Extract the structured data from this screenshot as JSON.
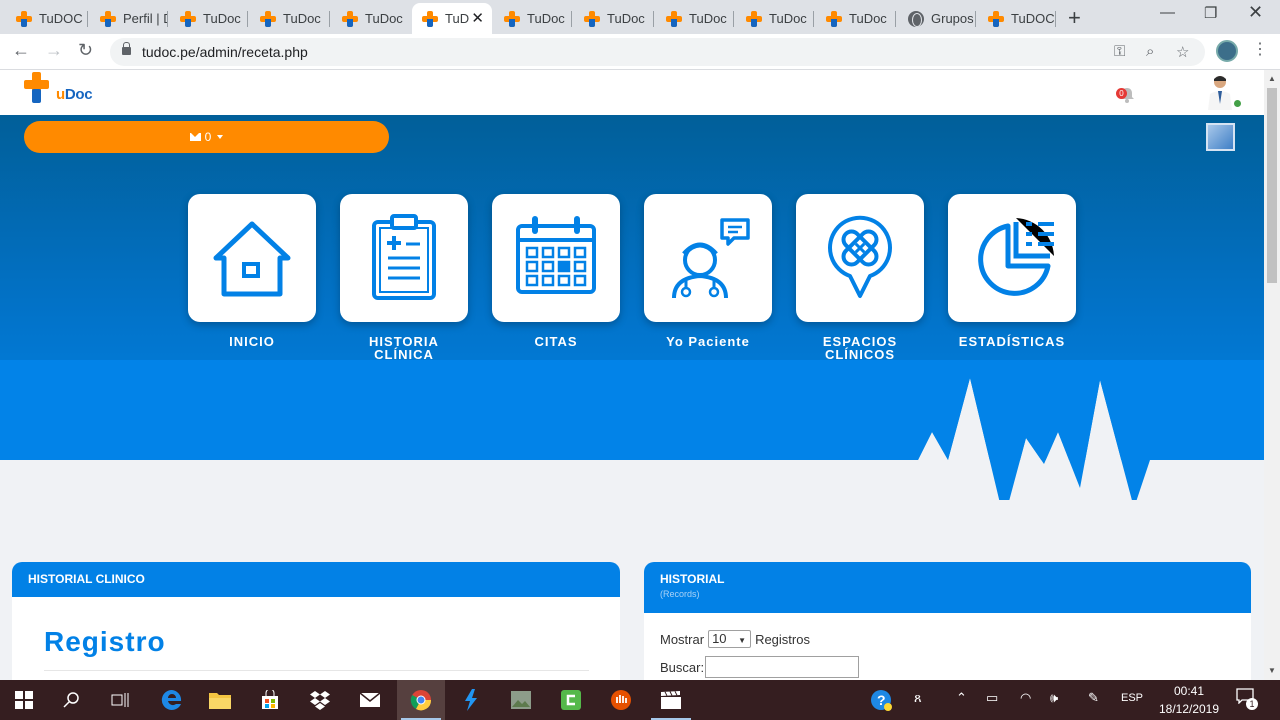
{
  "browser": {
    "tabs": [
      {
        "title": "TuDOC",
        "icon": "tudoc-favicon"
      },
      {
        "title": "Perfil | D",
        "icon": "tudoc-favicon"
      },
      {
        "title": "TuDoc",
        "icon": "tudoc-favicon"
      },
      {
        "title": "TuDoc",
        "icon": "tudoc-favicon"
      },
      {
        "title": "TuDoc",
        "icon": "tudoc-favicon"
      },
      {
        "title": "TuD",
        "icon": "tudoc-favicon",
        "active": true
      },
      {
        "title": "TuDoc",
        "icon": "tudoc-favicon"
      },
      {
        "title": "TuDoc",
        "icon": "tudoc-favicon"
      },
      {
        "title": "TuDoc",
        "icon": "tudoc-favicon"
      },
      {
        "title": "TuDoc",
        "icon": "tudoc-favicon"
      },
      {
        "title": "TuDoc",
        "icon": "tudoc-favicon"
      },
      {
        "title": "Grupos",
        "icon": "globe-icon"
      },
      {
        "title": "TuDOC",
        "icon": "tudoc-favicon"
      }
    ],
    "url": "tudoc.pe/admin/receta.php"
  },
  "header": {
    "logo_text_prefix": "u",
    "logo_text_suffix": "Doc",
    "notification_count": "0"
  },
  "hero": {
    "messages_count": "0",
    "menu": [
      {
        "label": "INICIO",
        "icon": "home-icon"
      },
      {
        "label": "HISTORIA\nCLÍNICA",
        "icon": "clipboard-icon"
      },
      {
        "label": "CITAS",
        "icon": "calendar-icon"
      },
      {
        "label": "Yo Paciente",
        "icon": "doctor-chat-icon"
      },
      {
        "label": "ESPACIOS\nCLÍNICOS",
        "icon": "location-medical-icon"
      },
      {
        "label": "ESTADÍSTICAS",
        "icon": "pie-chart-icon"
      }
    ]
  },
  "panels": {
    "left": {
      "title": "HISTORIAL CLINICO",
      "heading": "Registro"
    },
    "right": {
      "title": "HISTORIAL",
      "subtitle": "(Records)",
      "show_label": "Mostrar",
      "page_size": "10",
      "records_label": "Registros",
      "search_label": "Buscar:"
    }
  },
  "taskbar": {
    "language": "ESP",
    "time": "00:41",
    "date": "18/12/2019",
    "notification_count": "1"
  },
  "colors": {
    "brand_blue": "#0281e6",
    "brand_orange": "#ff8a00",
    "hero_dark": "#015f99"
  }
}
